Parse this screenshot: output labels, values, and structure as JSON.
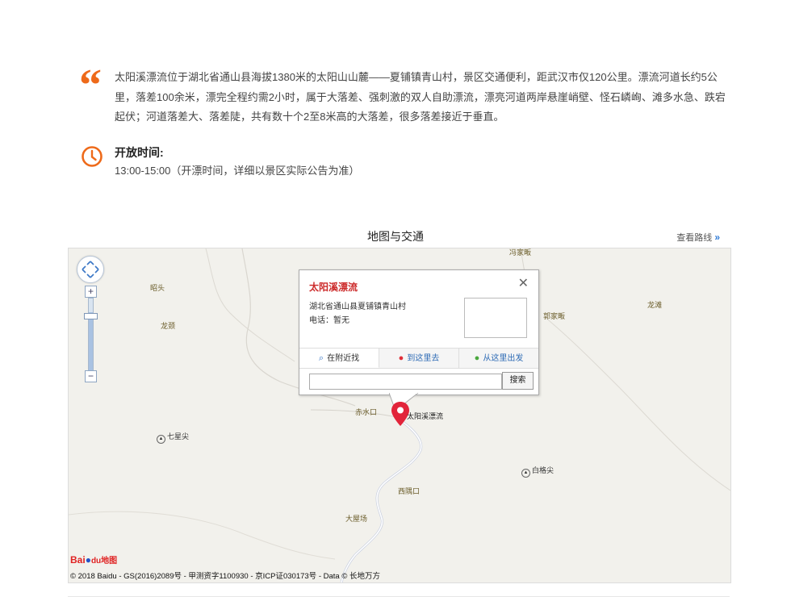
{
  "intro": {
    "text": "太阳溪漂流位于湖北省通山县海拔1380米的太阳山山麓——夏铺镇青山村，景区交通便利，距武汉市仅120公里。漂流河道长约5公里，落差100余米，漂完全程约需2小时，属于大落差、强刺激的双人自助漂流，漂亮河道两岸悬崖峭壁、怪石嶙峋、滩多水急、跌宕起伏；河道落差大、落差陡，共有数十个2至8米高的大落差，很多落差接近于垂直。"
  },
  "hours": {
    "title": "开放时间:",
    "text": "13:00-15:00（开漂时间，详细以景区实际公告为准）"
  },
  "map_section": {
    "title": "地图与交通",
    "route_link": "查看路线"
  },
  "map": {
    "places": {
      "zhaotou": "昭头",
      "longjing": "龙颈",
      "fengjiafan": "冯家畈",
      "guojiafan": "郭家畈",
      "longtan": "龙滩",
      "chishuikou": "赤水口",
      "xiyukou": "西隅口",
      "dawuchang": "大屋场"
    },
    "peaks": {
      "qixingjian": "七星尖",
      "baigejian": "白格尖"
    },
    "marker_label": "太阳溪漂流",
    "popup": {
      "title": "太阳溪漂流",
      "address": "湖北省通山县夏铺镇青山村",
      "phone": "电话：暂无",
      "tabs": [
        "在附近找",
        "到这里去",
        "从这里出发"
      ],
      "search_button": "搜索",
      "search_value": ""
    },
    "logo": {
      "bai": "Bai",
      "du": "du",
      "ditu": "地图"
    },
    "copyright": "© 2018 Baidu - GS(2016)2089号 - 甲测资字1100930 - 京ICP证030173号 - Data © 长地万方"
  },
  "colors": {
    "accent": "#ee6a1a",
    "popup_title": "#cc2a2a",
    "link": "#2e6bb5",
    "map_bg": "#f2f1ec"
  },
  "icons": {
    "quote": "quote-mark-icon",
    "clock": "clock-icon",
    "pan": "map-pan-icon",
    "marker": "map-marker-icon",
    "close": "close-icon"
  }
}
